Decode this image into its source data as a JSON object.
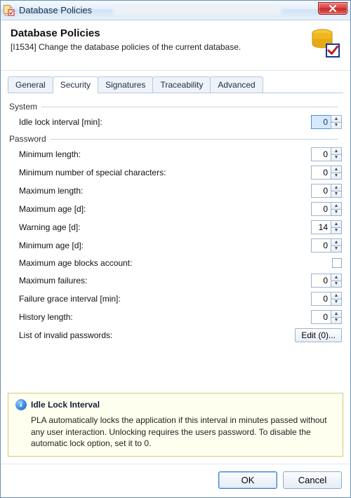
{
  "window": {
    "title": "Database Policies"
  },
  "header": {
    "title": "Database Policies",
    "subtitle": "[I1534] Change the database policies of the current database."
  },
  "tabs": {
    "general": "General",
    "security": "Security",
    "signatures": "Signatures",
    "traceability": "Traceability",
    "advanced": "Advanced",
    "active": "security"
  },
  "groups": {
    "system": "System",
    "password": "Password"
  },
  "fields": {
    "idle_lock": {
      "label": "Idle lock interval [min]:",
      "value": "0"
    },
    "min_length": {
      "label": "Minimum length:",
      "value": "0"
    },
    "min_special": {
      "label": "Minimum number of special characters:",
      "value": "0"
    },
    "max_length": {
      "label": "Maximum length:",
      "value": "0"
    },
    "max_age": {
      "label": "Maximum age [d]:",
      "value": "0"
    },
    "warn_age": {
      "label": "Warning age [d]:",
      "value": "14"
    },
    "min_age": {
      "label": "Minimum age [d]:",
      "value": "0"
    },
    "block_account": {
      "label": "Maximum age blocks account:",
      "checked": false
    },
    "max_failures": {
      "label": "Maximum failures:",
      "value": "0"
    },
    "grace_interval": {
      "label": "Failure grace interval [min]:",
      "value": "0"
    },
    "history_length": {
      "label": "History length:",
      "value": "0"
    },
    "invalid_list": {
      "label": "List of invalid passwords:",
      "button": "Edit (0)..."
    }
  },
  "info": {
    "title": "Idle Lock Interval",
    "body": "PLA automatically locks the application if this interval in minutes passed without any user interaction. Unlocking requires the users password. To disable the automatic lock option, set it to 0."
  },
  "buttons": {
    "ok": "OK",
    "cancel": "Cancel"
  },
  "icons": {
    "app": "database-policies-icon",
    "db": "database-cylinder-icon",
    "check": "verify-check-icon",
    "info": "info-icon",
    "close": "close-icon"
  }
}
